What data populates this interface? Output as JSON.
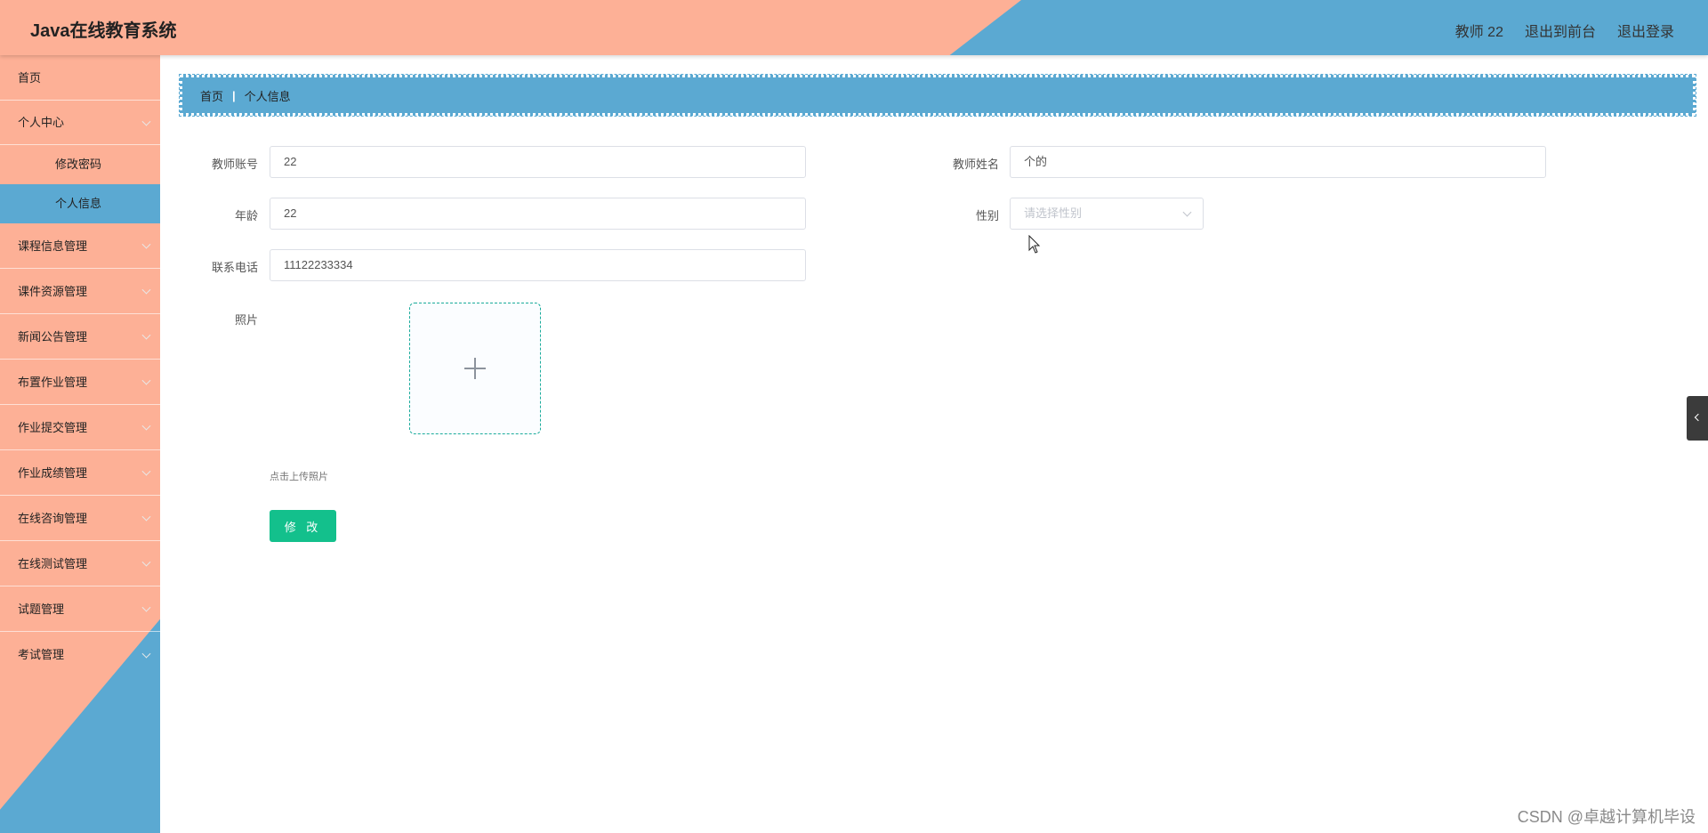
{
  "header": {
    "title": "Java在线教育系统",
    "links": [
      "教师 22",
      "退出到前台",
      "退出登录"
    ]
  },
  "sidebar": {
    "items": [
      {
        "label": "首页",
        "has_arrow": false
      },
      {
        "label": "个人中心",
        "has_arrow": true
      },
      {
        "label": "修改密码",
        "sub": true
      },
      {
        "label": "个人信息",
        "sub": true,
        "active": true
      },
      {
        "label": "课程信息管理",
        "has_arrow": true
      },
      {
        "label": "课件资源管理",
        "has_arrow": true
      },
      {
        "label": "新闻公告管理",
        "has_arrow": true
      },
      {
        "label": "布置作业管理",
        "has_arrow": true
      },
      {
        "label": "作业提交管理",
        "has_arrow": true
      },
      {
        "label": "作业成绩管理",
        "has_arrow": true
      },
      {
        "label": "在线咨询管理",
        "has_arrow": true
      },
      {
        "label": "在线测试管理",
        "has_arrow": true
      },
      {
        "label": "试题管理",
        "has_arrow": true
      },
      {
        "label": "考试管理",
        "has_arrow": true
      }
    ]
  },
  "breadcrumb": {
    "home": "首页",
    "separator": "|",
    "current": "个人信息"
  },
  "form": {
    "account_label": "教师账号",
    "account_value": "22",
    "name_label": "教师姓名",
    "name_value": "个的",
    "age_label": "年龄",
    "age_value": "22",
    "gender_label": "性别",
    "gender_placeholder": "请选择性别",
    "phone_label": "联系电话",
    "phone_value": "11122233334",
    "photo_label": "照片",
    "upload_tip": "点击上传照片",
    "submit_label": "修 改"
  },
  "watermark": "CSDN @卓越计算机毕设",
  "colors": {
    "salmon": "#fdb096",
    "blue": "#5ba9d2",
    "button_green": "#13c08c"
  }
}
